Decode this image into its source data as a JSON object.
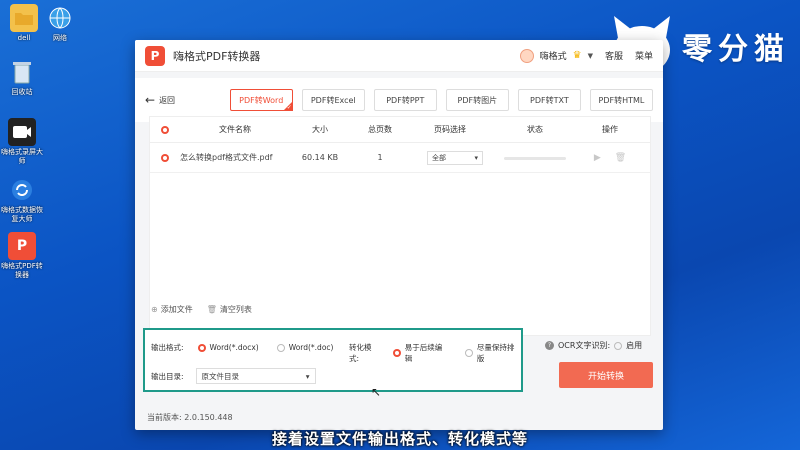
{
  "desktop": {
    "icons": [
      {
        "label": "dell"
      },
      {
        "label": "网络"
      },
      {
        "label": "回收站"
      },
      {
        "label": "嗨格式录屏大师"
      },
      {
        "label": "嗨格式数据恢复大师"
      },
      {
        "label": "嗨格式PDF转换器"
      }
    ]
  },
  "brand": {
    "text": "零分猫"
  },
  "app": {
    "logo_letter": "P",
    "title": "嗨格式PDF转换器",
    "user_name": "嗨格式",
    "support": "客服",
    "menu": "菜单"
  },
  "nav": {
    "back_label": "返回",
    "tabs": [
      {
        "label": "PDF转Word"
      },
      {
        "label": "PDF转Excel"
      },
      {
        "label": "PDF转PPT"
      },
      {
        "label": "PDF转图片"
      },
      {
        "label": "PDF转TXT"
      },
      {
        "label": "PDF转HTML"
      }
    ]
  },
  "file_table": {
    "headers": [
      "文件名称",
      "大小",
      "总页数",
      "页码选择",
      "状态",
      "操作"
    ],
    "rows": [
      {
        "name": "怎么转换pdf格式文件.pdf",
        "size": "60.14 KB",
        "pages": "1",
        "range": "全部"
      }
    ]
  },
  "actions": {
    "add": "添加文件",
    "clear": "清空列表"
  },
  "settings": {
    "format_label": "输出格式:",
    "format_options": [
      "Word(*.docx)",
      "Word(*.doc)"
    ],
    "mode_label": "转化模式:",
    "mode_options": [
      "易于后续编辑",
      "尽量保持排版"
    ],
    "dir_label": "输出目录:",
    "dir_value": "原文件目录"
  },
  "ocr": {
    "label": "OCR文字识别:",
    "option": "启用"
  },
  "start_button": "开始转换",
  "version": "当前版本: 2.0.150.448",
  "subtitle": "接着设置文件输出格式、转化模式等",
  "colors": {
    "accent": "#f04e37",
    "highlight_box": "#1f9a8a",
    "desktop": "#0b54c4"
  }
}
